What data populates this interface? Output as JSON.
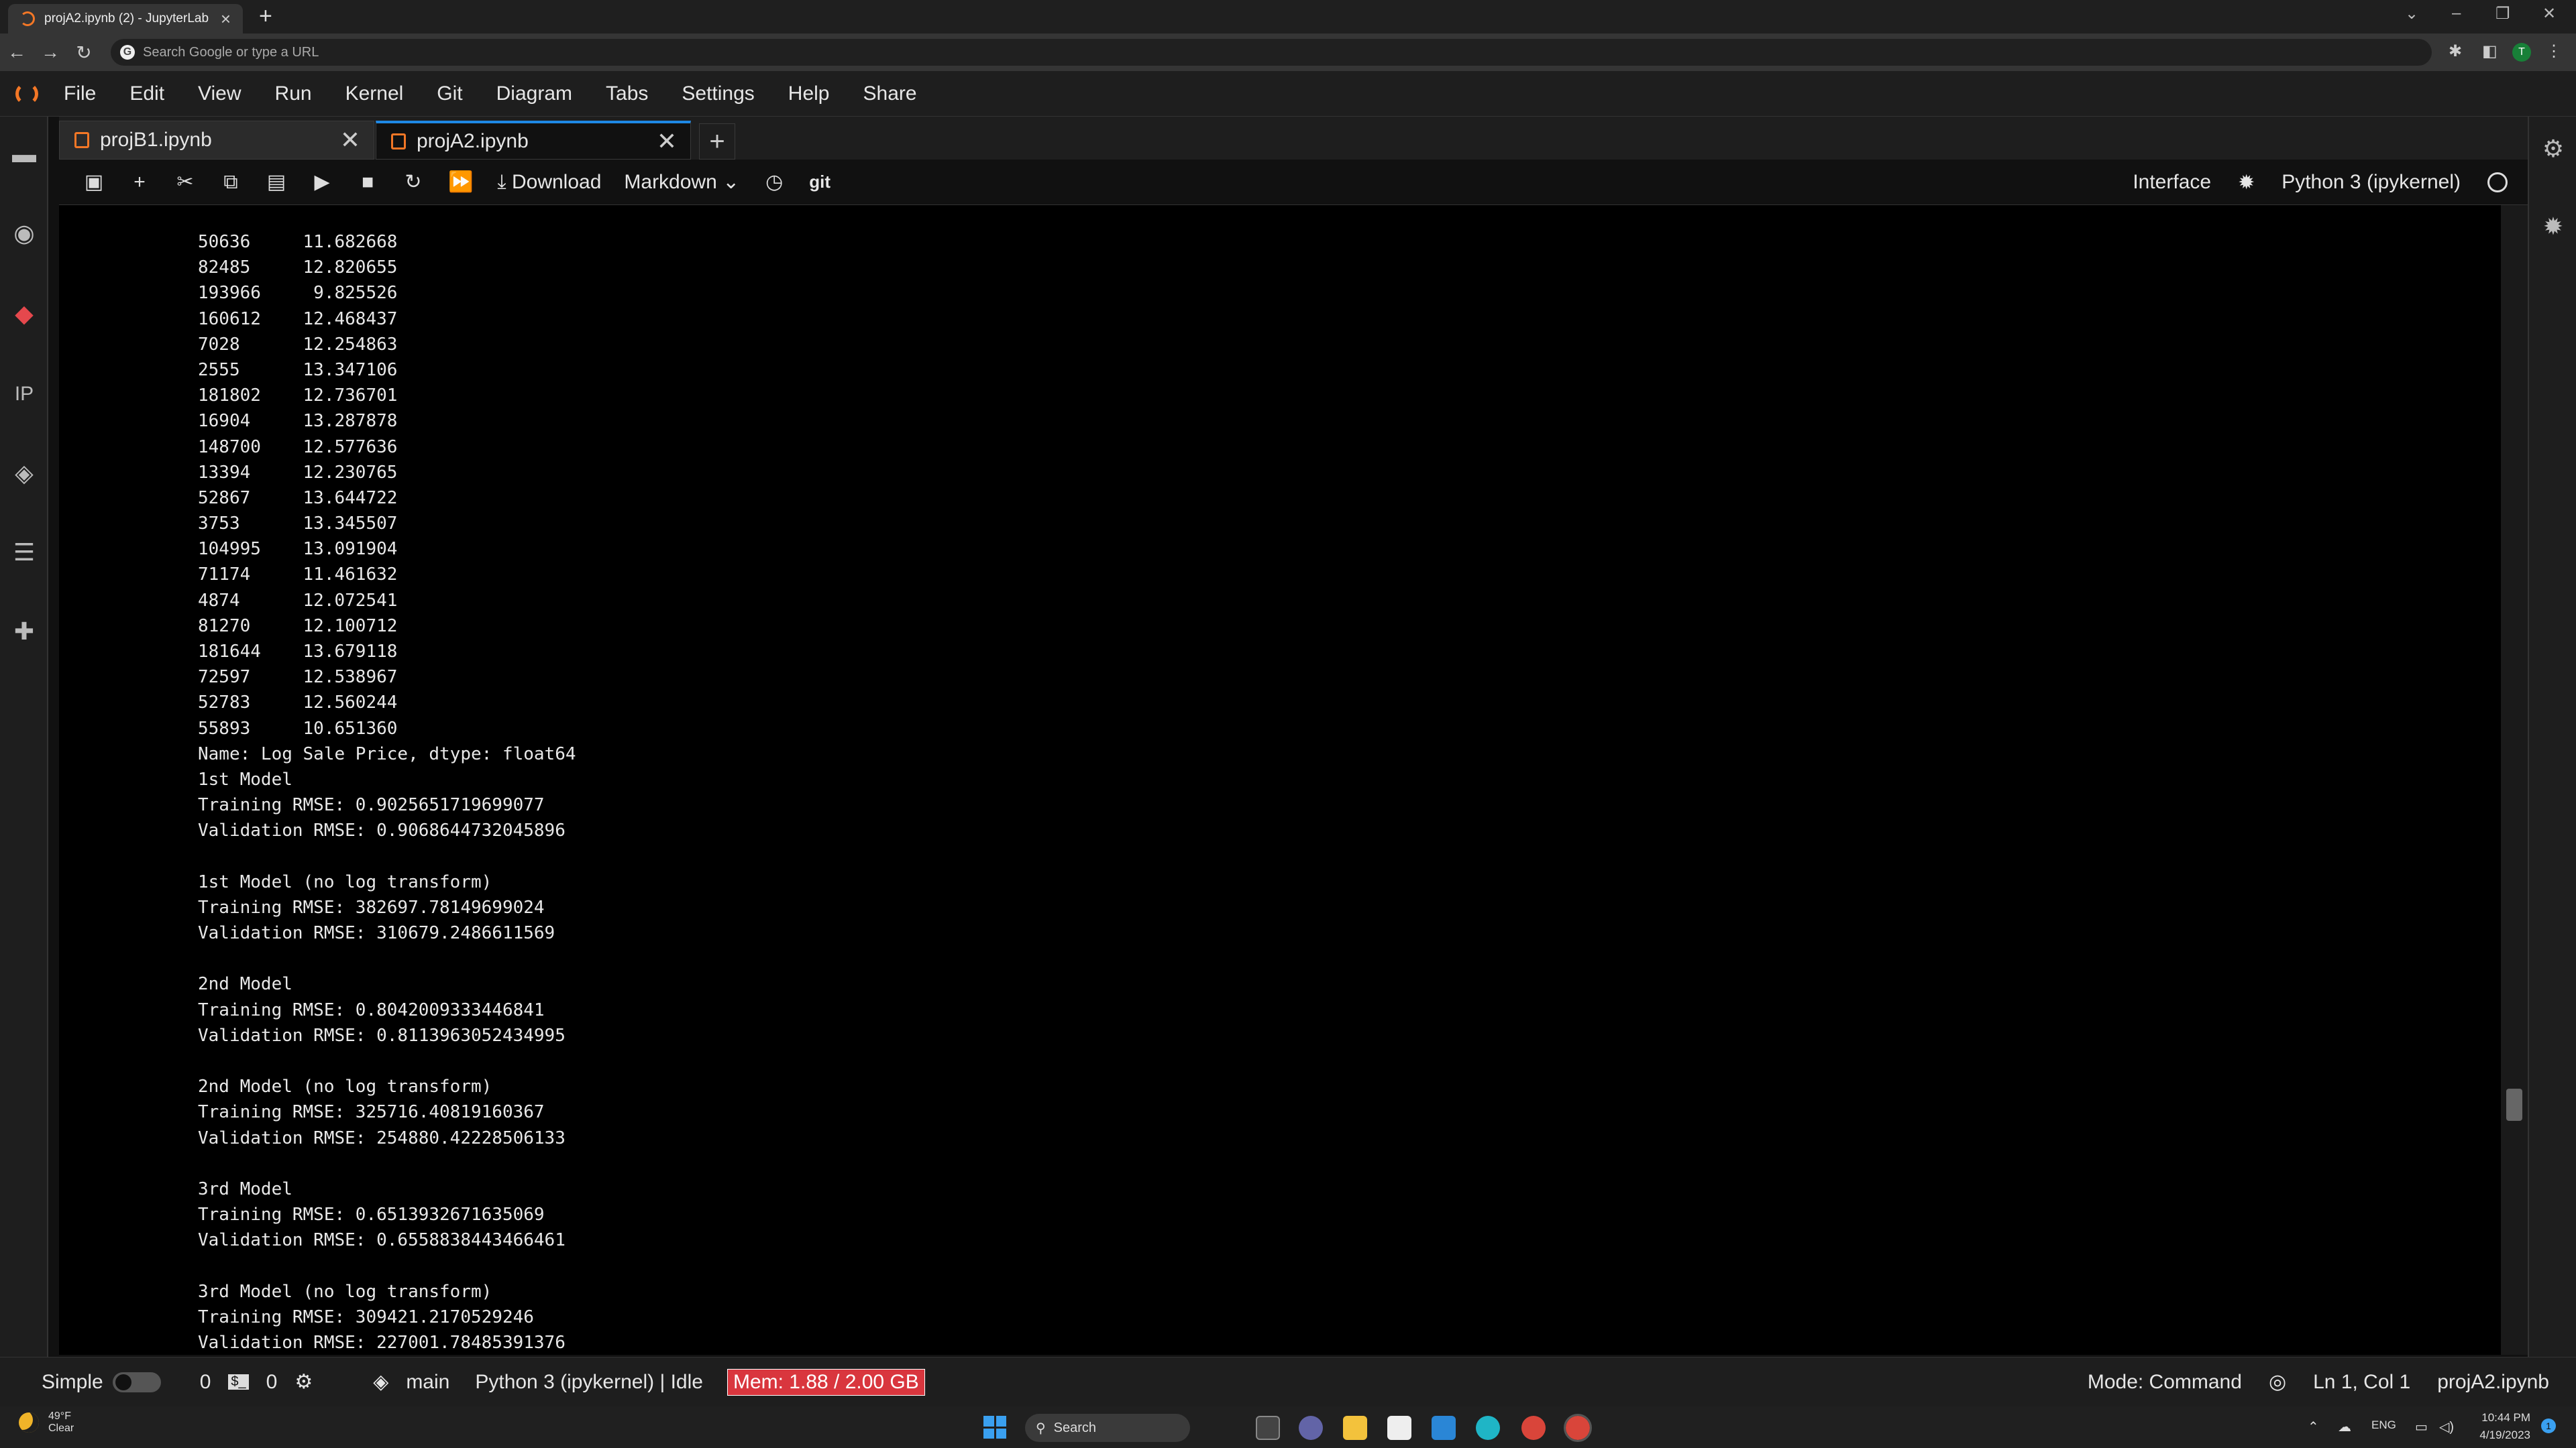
{
  "browser": {
    "tab_title": "projA2.ipynb (2) - JupyterLab",
    "new_tab": "+",
    "address_placeholder": "Search Google or type a URL"
  },
  "menu": [
    "File",
    "Edit",
    "View",
    "Run",
    "Kernel",
    "Git",
    "Diagram",
    "Tabs",
    "Settings",
    "Help",
    "Share"
  ],
  "notebook_tabs": [
    {
      "label": "projB1.ipynb",
      "active": false
    },
    {
      "label": "projA2.ipynb",
      "active": true
    }
  ],
  "toolbar": {
    "download_label": "Download",
    "cell_type": "Markdown",
    "git_label": "git",
    "interface_label": "Interface",
    "kernel_label": "Python 3 (ipykernel)"
  },
  "output_lines": [
    "50636     11.682668",
    "82485     12.820655",
    "193966     9.825526",
    "160612    12.468437",
    "7028      12.254863",
    "2555      13.347106",
    "181802    12.736701",
    "16904     13.287878",
    "148700    12.577636",
    "13394     12.230765",
    "52867     13.644722",
    "3753      13.345507",
    "104995    13.091904",
    "71174     11.461632",
    "4874      12.072541",
    "81270     12.100712",
    "181644    13.679118",
    "72597     12.538967",
    "52783     12.560244",
    "55893     10.651360",
    "Name: Log Sale Price, dtype: float64",
    "1st Model",
    "Training RMSE: 0.9025651719699077",
    "Validation RMSE: 0.9068644732045896",
    "",
    "1st Model (no log transform)",
    "Training RMSE: 382697.78149699024",
    "Validation RMSE: 310679.2486611569",
    "",
    "2nd Model",
    "Training RMSE: 0.8042009333446841",
    "Validation RMSE: 0.8113963052434995",
    "",
    "2nd Model (no log transform)",
    "Training RMSE: 325716.40819160367",
    "Validation RMSE: 254880.42228506133",
    "",
    "3rd Model",
    "Training RMSE: 0.6513932671635069",
    "Validation RMSE: 0.6558838443466461",
    "",
    "3rd Model (no log transform)",
    "Training RMSE: 309421.2170529246",
    "Validation RMSE: 227001.78485391376"
  ],
  "status": {
    "mode_simple": "Simple",
    "count_a": "0",
    "terminal_label": "$_",
    "count_b": "0",
    "branch": "main",
    "kernel_status": "Python 3 (ipykernel) | Idle",
    "memory": "Mem: 1.88 / 2.00 GB",
    "mode": "Mode: Command",
    "cursor": "Ln 1, Col 1",
    "filename": "projA2.ipynb"
  },
  "taskbar": {
    "weather_temp": "49°F",
    "weather_cond": "Clear",
    "search": "Search",
    "lang": "ENG",
    "time": "10:44 PM",
    "date": "4/19/2023",
    "notif_count": "1"
  },
  "colors": {
    "accent": "#1e88e5",
    "jupyter_orange": "#f37726",
    "mem_alert": "#d9363e"
  }
}
